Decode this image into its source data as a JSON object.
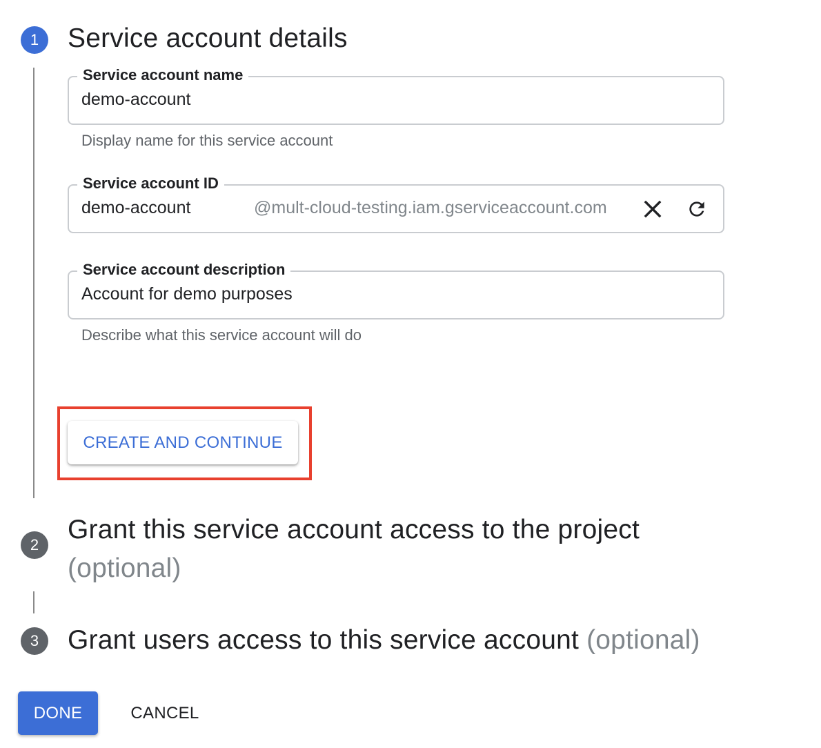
{
  "steps": [
    {
      "number": "1",
      "title": "Service account details",
      "optional": ""
    },
    {
      "number": "2",
      "title": "Grant this service account access to the project",
      "optional": "(optional)"
    },
    {
      "number": "3",
      "title": "Grant users access to this service account",
      "optional": "(optional)"
    }
  ],
  "form": {
    "name_field": {
      "label": "Service account name",
      "value": "demo-account",
      "hint": "Display name for this service account"
    },
    "id_field": {
      "label": "Service account ID",
      "value": "demo-account",
      "suffix": "@mult-cloud-testing.iam.gserviceaccount.com",
      "clear_icon": "close-icon",
      "refresh_icon": "refresh-icon"
    },
    "description_field": {
      "label": "Service account description",
      "value": "Account for demo purposes",
      "hint": "Describe what this service account will do"
    },
    "create_button": "CREATE AND CONTINUE"
  },
  "footer": {
    "done_label": "DONE",
    "cancel_label": "CANCEL"
  },
  "colors": {
    "primary": "#3c6ed6",
    "highlight": "#e8402e",
    "inactive_step": "#5f6368"
  }
}
